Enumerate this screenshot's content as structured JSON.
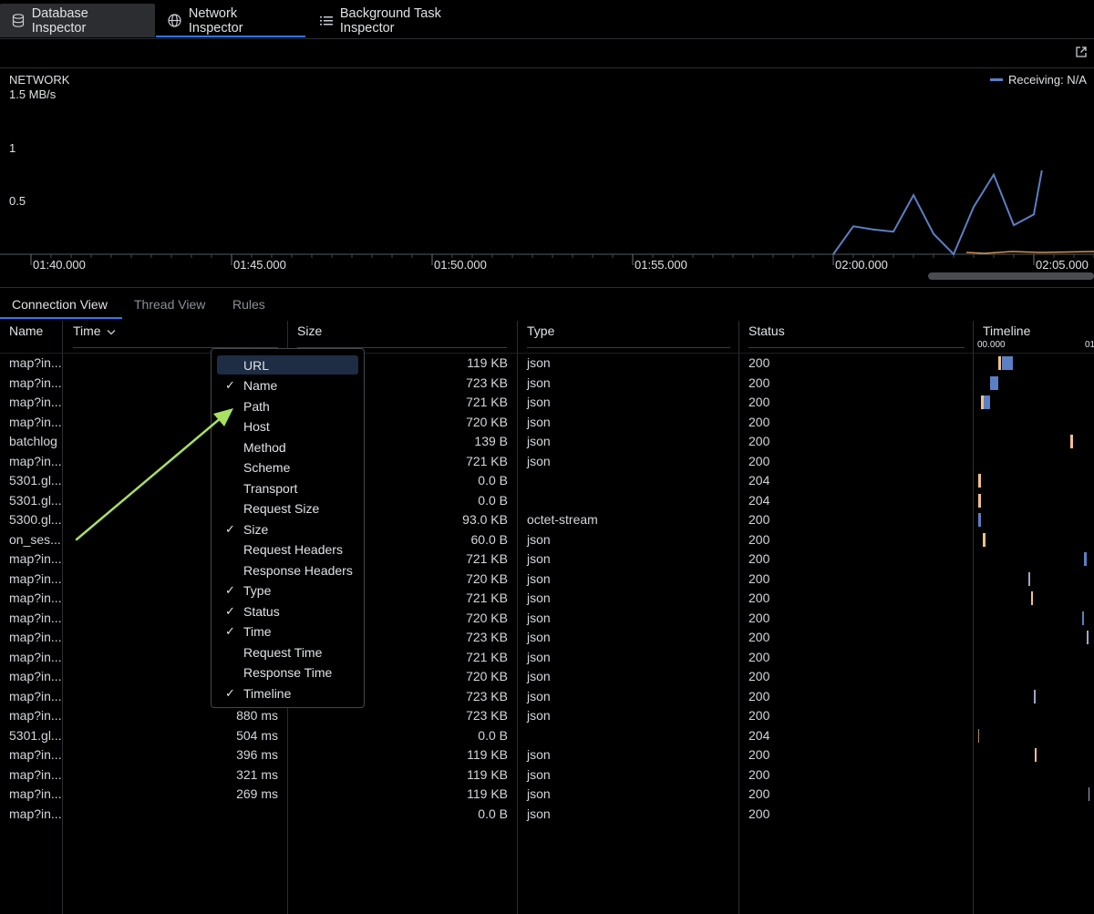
{
  "tabs": [
    {
      "label": "Database Inspector",
      "icon": "database-icon",
      "active": false
    },
    {
      "label": "Network Inspector",
      "icon": "globe-icon",
      "active": true
    },
    {
      "label": "Background Task Inspector",
      "icon": "list-icon",
      "active": false
    }
  ],
  "toolbar": {
    "expand_icon": "external-link-icon"
  },
  "chart": {
    "title": "NETWORK",
    "ymax_label": "1.5 MB/s",
    "legend": "Receiving: N/A",
    "accent": "#5b7fc4"
  },
  "chart_data": {
    "type": "line",
    "title": "NETWORK",
    "ylabel": "1.5 MB/s",
    "yticks": [
      "1",
      "0.5"
    ],
    "ylim": [
      0,
      1.5
    ],
    "xticks": [
      "01:40.000",
      "01:45.000",
      "01:50.000",
      "01:55.000",
      "02:00.000",
      "02:05.000"
    ],
    "series": [
      {
        "name": "Receiving: N/A",
        "color": "#5b7fc4",
        "x": [
          "02:00.0",
          "02:00.5",
          "02:01.0",
          "02:01.5",
          "02:02.0",
          "02:02.5",
          "02:03.0",
          "02:03.5",
          "02:04.0",
          "02:04.5",
          "02:05.0",
          "02:05.2"
        ],
        "values": [
          0.0,
          0.26,
          0.23,
          0.21,
          0.55,
          0.19,
          0.0,
          0.44,
          0.74,
          0.27,
          0.37,
          0.78
        ]
      }
    ]
  },
  "view_tabs": [
    {
      "label": "Connection View",
      "active": true
    },
    {
      "label": "Thread View",
      "active": false
    },
    {
      "label": "Rules",
      "active": false
    }
  ],
  "table": {
    "columns": {
      "name": "Name",
      "time": "Time",
      "size": "Size",
      "type": "Type",
      "status": "Status",
      "timeline": "Timeline"
    },
    "timeline_start": "00.000",
    "timeline_next": "01",
    "rows": [
      {
        "name": "map?in...",
        "time": "",
        "size": "119 KB",
        "type": "json",
        "status": "200"
      },
      {
        "name": "map?in...",
        "time": "",
        "size": "723 KB",
        "type": "json",
        "status": "200"
      },
      {
        "name": "map?in...",
        "time": "",
        "size": "721 KB",
        "type": "json",
        "status": "200"
      },
      {
        "name": "map?in...",
        "time": "",
        "size": "720 KB",
        "type": "json",
        "status": "200"
      },
      {
        "name": "batchlog",
        "time": "",
        "size": "139 B",
        "type": "json",
        "status": "200"
      },
      {
        "name": "map?in...",
        "time": "",
        "size": "721 KB",
        "type": "json",
        "status": "200"
      },
      {
        "name": "5301.gl...",
        "time": "",
        "size": "0.0 B",
        "type": "",
        "status": "204"
      },
      {
        "name": "5301.gl...",
        "time": "",
        "size": "0.0 B",
        "type": "",
        "status": "204"
      },
      {
        "name": "5300.gl...",
        "time": "",
        "size": "93.0 KB",
        "type": "octet-stream",
        "status": "200"
      },
      {
        "name": "on_ses...",
        "time": "",
        "size": "60.0 B",
        "type": "json",
        "status": "200"
      },
      {
        "name": "map?in...",
        "time": "",
        "size": "721 KB",
        "type": "json",
        "status": "200"
      },
      {
        "name": "map?in...",
        "time": "",
        "size": "720 KB",
        "type": "json",
        "status": "200"
      },
      {
        "name": "map?in...",
        "time": "",
        "size": "721 KB",
        "type": "json",
        "status": "200"
      },
      {
        "name": "map?in...",
        "time": "",
        "size": "720 KB",
        "type": "json",
        "status": "200"
      },
      {
        "name": "map?in...",
        "time": "",
        "size": "723 KB",
        "type": "json",
        "status": "200"
      },
      {
        "name": "map?in...",
        "time": "",
        "size": "721 KB",
        "type": "json",
        "status": "200"
      },
      {
        "name": "map?in...",
        "time": "",
        "size": "720 KB",
        "type": "json",
        "status": "200"
      },
      {
        "name": "map?in...",
        "time": "",
        "size": "723 KB",
        "type": "json",
        "status": "200"
      },
      {
        "name": "map?in...",
        "time": "880 ms",
        "size": "723 KB",
        "type": "json",
        "status": "200"
      },
      {
        "name": "5301.gl...",
        "time": "504 ms",
        "size": "0.0 B",
        "type": "",
        "status": "204"
      },
      {
        "name": "map?in...",
        "time": "396 ms",
        "size": "119 KB",
        "type": "json",
        "status": "200"
      },
      {
        "name": "map?in...",
        "time": "321 ms",
        "size": "119 KB",
        "type": "json",
        "status": "200"
      },
      {
        "name": "map?in...",
        "time": "269 ms",
        "size": "119 KB",
        "type": "json",
        "status": "200"
      },
      {
        "name": "map?in...",
        "time": "",
        "size": "0.0 B",
        "type": "json",
        "status": "200"
      }
    ]
  },
  "column_menu": {
    "items": [
      {
        "label": "URL",
        "checked": false,
        "highlighted": true
      },
      {
        "label": "Name",
        "checked": true
      },
      {
        "label": "Path",
        "checked": false
      },
      {
        "label": "Host",
        "checked": false
      },
      {
        "label": "Method",
        "checked": false
      },
      {
        "label": "Scheme",
        "checked": false
      },
      {
        "label": "Transport",
        "checked": false
      },
      {
        "label": "Request Size",
        "checked": false
      },
      {
        "label": "Size",
        "checked": true
      },
      {
        "label": "Request Headers",
        "checked": false
      },
      {
        "label": "Response Headers",
        "checked": false
      },
      {
        "label": "Type",
        "checked": true
      },
      {
        "label": "Status",
        "checked": true
      },
      {
        "label": "Time",
        "checked": true
      },
      {
        "label": "Request Time",
        "checked": false
      },
      {
        "label": "Response Time",
        "checked": false
      },
      {
        "label": "Timeline",
        "checked": true
      }
    ],
    "checkmark": "✓"
  },
  "annotation": {
    "arrow_color": "#a8e05f"
  }
}
